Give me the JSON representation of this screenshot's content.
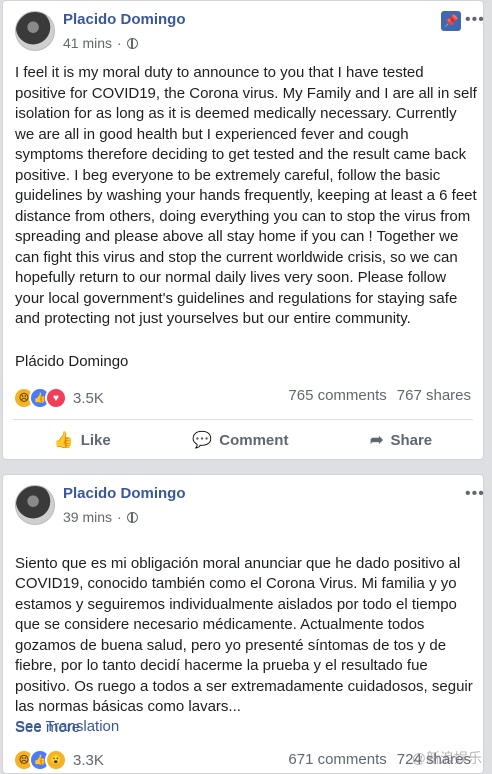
{
  "post1": {
    "author": "Placido Domingo",
    "time": "41 mins",
    "text": "I feel it is my moral duty to announce to you that I have tested positive for COVID19, the Corona virus. My Family and I are all in self isolation for as long as it is deemed medically necessary. Currently we are all in good health but I experienced fever and cough symptoms therefore deciding to get tested and the result came back positive. I beg everyone to be extremely careful, follow the basic guidelines by washing your hands frequently, keeping at least a 6 feet distance from others, doing everything you can to stop the virus from spreading and please above all stay home if you can ! Together we can fight this virus and stop the current worldwide crisis, so we can hopefully return to our normal daily lives very soon. Please follow your local government's guidelines and regulations for staying safe and protecting not just yourselves but our entire community.",
    "signature": "Plácido Domingo",
    "reactions_count": "3.5K",
    "comments": "765 comments",
    "shares": "767 shares",
    "actions": {
      "like": "Like",
      "comment": "Comment",
      "share": "Share"
    }
  },
  "post2": {
    "author": "Placido Domingo",
    "time": "39 mins",
    "text": "Siento que es mi obligación moral anunciar que he dado positivo al COVID19, conocido también como el Corona Virus. Mi familia y yo estamos y seguiremos individualmente aislados por todo el tiempo que se considere necesario médicamente. Actualmente todos gozamos de buena salud, pero yo presenté síntomas de tos y de fiebre, por lo tanto decidí hacerme la prueba y el resultado fue positivo. Os ruego a todos a ser extremadamente cuidadosos, seguir las normas básicas como lavars...",
    "see_more": "See more",
    "see_translation": "See Translation",
    "reactions_count": "3.3K",
    "comments": "671 comments",
    "shares": "724 shares"
  },
  "watermark": "@新浪娱乐"
}
